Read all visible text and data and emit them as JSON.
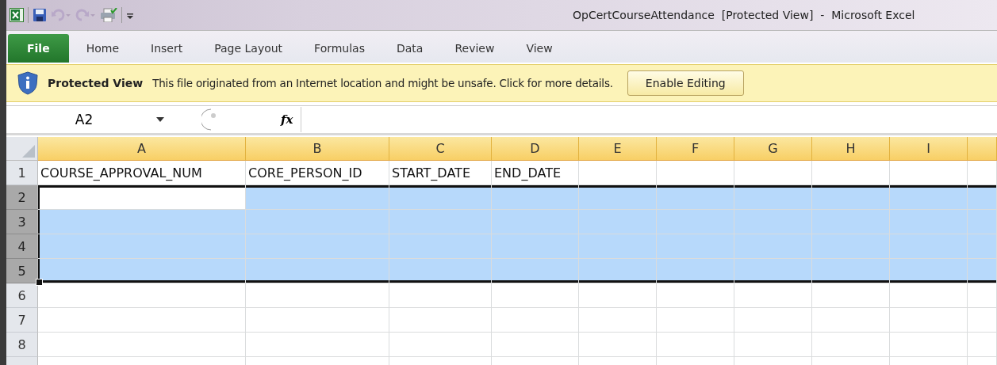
{
  "window": {
    "title": "OpCertCourseAttendance  [Protected View]  -  Microsoft Excel"
  },
  "ribbon_tabs": [
    {
      "label": "File",
      "kind": "file",
      "selected": false
    },
    {
      "label": "Home",
      "kind": "tab",
      "selected": false
    },
    {
      "label": "Insert",
      "kind": "tab",
      "selected": false
    },
    {
      "label": "Page Layout",
      "kind": "tab",
      "selected": false
    },
    {
      "label": "Formulas",
      "kind": "tab",
      "selected": false
    },
    {
      "label": "Data",
      "kind": "tab",
      "selected": false
    },
    {
      "label": "Review",
      "kind": "tab",
      "selected": false
    },
    {
      "label": "View",
      "kind": "tab",
      "selected": false
    }
  ],
  "message_bar": {
    "title": "Protected View",
    "message": "This file originated from an Internet location and might be unsafe. Click for more details.",
    "button": "Enable Editing"
  },
  "formula_bar": {
    "name_box": "A2",
    "fx": "fx"
  },
  "columns": [
    {
      "label": "A",
      "selected": true
    },
    {
      "label": "B",
      "selected": true
    },
    {
      "label": "C",
      "selected": true
    },
    {
      "label": "D",
      "selected": true
    },
    {
      "label": "E",
      "selected": true
    },
    {
      "label": "F",
      "selected": true
    },
    {
      "label": "G",
      "selected": true
    },
    {
      "label": "H",
      "selected": true
    },
    {
      "label": "I",
      "selected": true
    }
  ],
  "rows": [
    {
      "label": "1",
      "selected": false,
      "cells": [
        "COURSE_APPROVAL_NUM",
        "CORE_PERSON_ID",
        "START_DATE",
        "END_DATE"
      ]
    },
    {
      "label": "2",
      "selected": true
    },
    {
      "label": "3",
      "selected": true
    },
    {
      "label": "4",
      "selected": true
    },
    {
      "label": "5",
      "selected": true
    },
    {
      "label": "6",
      "selected": false
    },
    {
      "label": "7",
      "selected": false
    },
    {
      "label": "8",
      "selected": false
    }
  ]
}
